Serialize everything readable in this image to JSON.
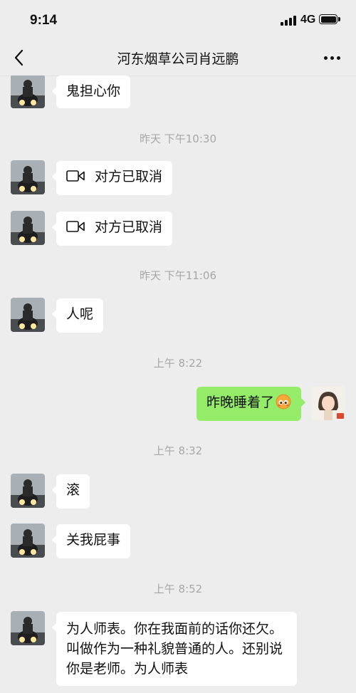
{
  "status_bar": {
    "time": "9:14",
    "network": "4G"
  },
  "header": {
    "title": "河东烟草公司肖远鹏"
  },
  "messages": {
    "m1": "鬼担心你",
    "ts1": "昨天 下午10:30",
    "m2": "对方已取消",
    "m3": "对方已取消",
    "ts2": "昨天 下午11:06",
    "m4": "人呢",
    "ts3": "上午 8:22",
    "m5": "昨晚睡着了",
    "ts4": "上午 8:32",
    "m6": "滚",
    "m7": "关我屁事",
    "ts5": "上午 8:52",
    "m8": "为人师表。你在我面前的话你还欠。叫做作为一种礼貌普通的人。还别说你是老师。为人师表"
  },
  "colors": {
    "background": "#ededed",
    "incoming_bubble": "#ffffff",
    "outgoing_bubble": "#95ec69",
    "timestamp": "#a7a7a7"
  },
  "icons": {
    "back": "chevron-left-icon",
    "more": "more-dots-icon",
    "video_call": "video-camera-icon",
    "emoji": "blush-emoji-icon"
  }
}
